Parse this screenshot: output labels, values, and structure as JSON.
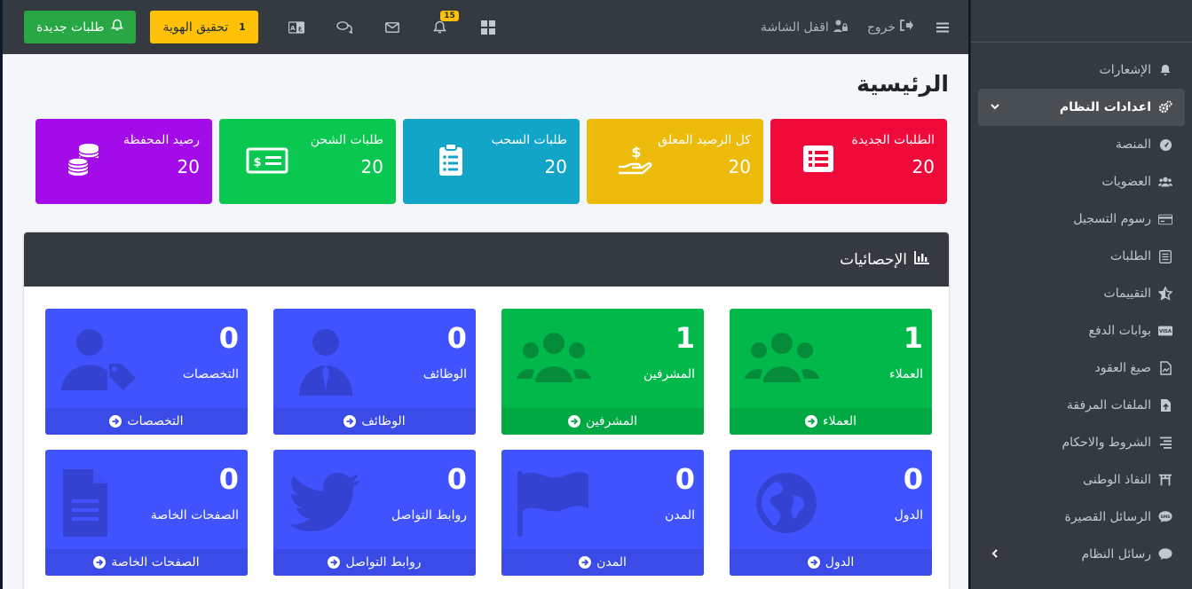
{
  "sidebar": {
    "items": [
      {
        "label": "الإشعارات",
        "icon": "bell-icon"
      },
      {
        "label": "اعدادات النظام",
        "icon": "cogs-icon",
        "active": true
      },
      {
        "label": "المنصة",
        "icon": "gauge-icon"
      },
      {
        "label": "العضويات",
        "icon": "users-icon"
      },
      {
        "label": "رسوم التسجيل",
        "icon": "credit-card-icon"
      },
      {
        "label": "الطلبات",
        "icon": "list-box-icon"
      },
      {
        "label": "التقييمات",
        "icon": "star-icon"
      },
      {
        "label": "بوابات الدفع",
        "icon": "visa-icon"
      },
      {
        "label": "صيغ العقود",
        "icon": "file-icon"
      },
      {
        "label": "الملفات المرفقة",
        "icon": "file-upload-icon"
      },
      {
        "label": "الشروط والاحكام",
        "icon": "align-icon"
      },
      {
        "label": "النفاذ الوطنى",
        "icon": "gate-icon"
      },
      {
        "label": "الرسائل القصيرة",
        "icon": "sms-icon"
      },
      {
        "label": "رسائل النظام",
        "icon": "comment-icon"
      }
    ]
  },
  "topbar": {
    "logout": "خروج",
    "lock_screen": "اقفل الشاشة",
    "new_requests": "طلبات جديدة",
    "verify_identity": "تحقيق الهوية",
    "verify_count": "1",
    "notifications_badge": "15"
  },
  "page_title": "الرئيسية",
  "summary_boxes": [
    {
      "label": "الطلبات الجديدة",
      "value": "20",
      "color": "#ef0a3a"
    },
    {
      "label": "كل الرصيد المعلق",
      "value": "20",
      "color": "#ecbb0c"
    },
    {
      "label": "طلبات السحب",
      "value": "20",
      "color": "#13a5c8"
    },
    {
      "label": "طلبات الشحن",
      "value": "20",
      "color": "#0ac84f"
    },
    {
      "label": "رصيد المحفظة",
      "value": "20",
      "color": "#a30be8"
    }
  ],
  "stats": {
    "title": "الإحصائيات",
    "tiles": [
      {
        "num": "1",
        "label": "العملاء",
        "footer": "العملاء",
        "color": "green",
        "icon": "users-icon"
      },
      {
        "num": "1",
        "label": "المشرفين",
        "footer": "المشرفين",
        "color": "green",
        "icon": "users-icon"
      },
      {
        "num": "0",
        "label": "الوظائف",
        "footer": "الوظائف",
        "color": "blue",
        "icon": "user-tie-icon"
      },
      {
        "num": "0",
        "label": "التخصصات",
        "footer": "التخصصات",
        "color": "blue",
        "icon": "user-tag-icon"
      },
      {
        "num": "0",
        "label": "الدول",
        "footer": "الدول",
        "color": "blue",
        "icon": "globe-icon"
      },
      {
        "num": "0",
        "label": "المدن",
        "footer": "المدن",
        "color": "blue",
        "icon": "flag-icon"
      },
      {
        "num": "0",
        "label": "روابط التواصل",
        "footer": "روابط التواصل",
        "color": "blue",
        "icon": "twitter-icon"
      },
      {
        "num": "0",
        "label": "الصفحات الخاصة",
        "footer": "الصفحات الخاصة",
        "color": "blue",
        "icon": "document-icon"
      }
    ]
  }
}
